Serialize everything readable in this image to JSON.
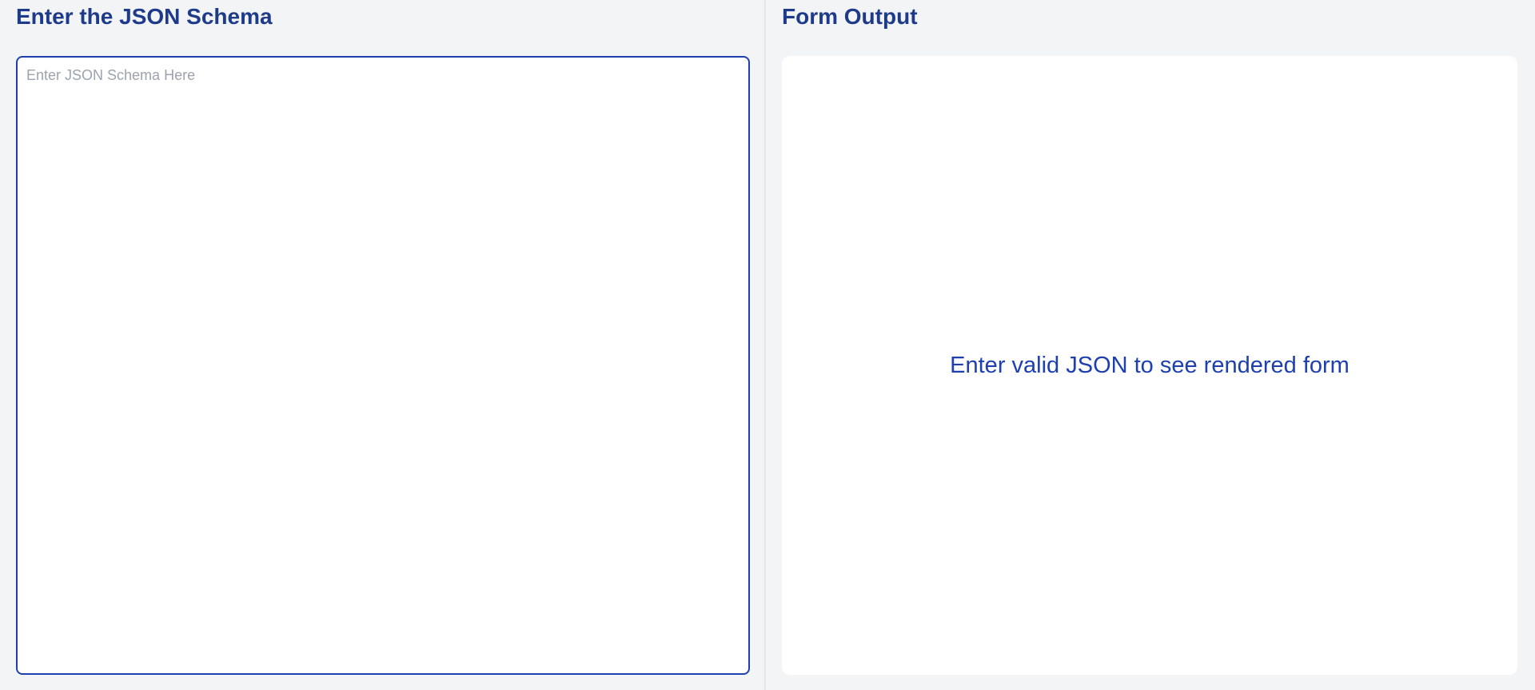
{
  "schema_pane": {
    "title": "Enter the JSON Schema",
    "input": {
      "value": "",
      "placeholder": "Enter JSON Schema Here"
    }
  },
  "output_pane": {
    "title": "Form Output",
    "empty_message": "Enter valid JSON to see rendered form"
  },
  "colors": {
    "accent": "#1e40af",
    "title": "#1e3a8a",
    "background": "#f3f4f6",
    "panel": "#ffffff",
    "placeholder": "#9ca3af"
  }
}
